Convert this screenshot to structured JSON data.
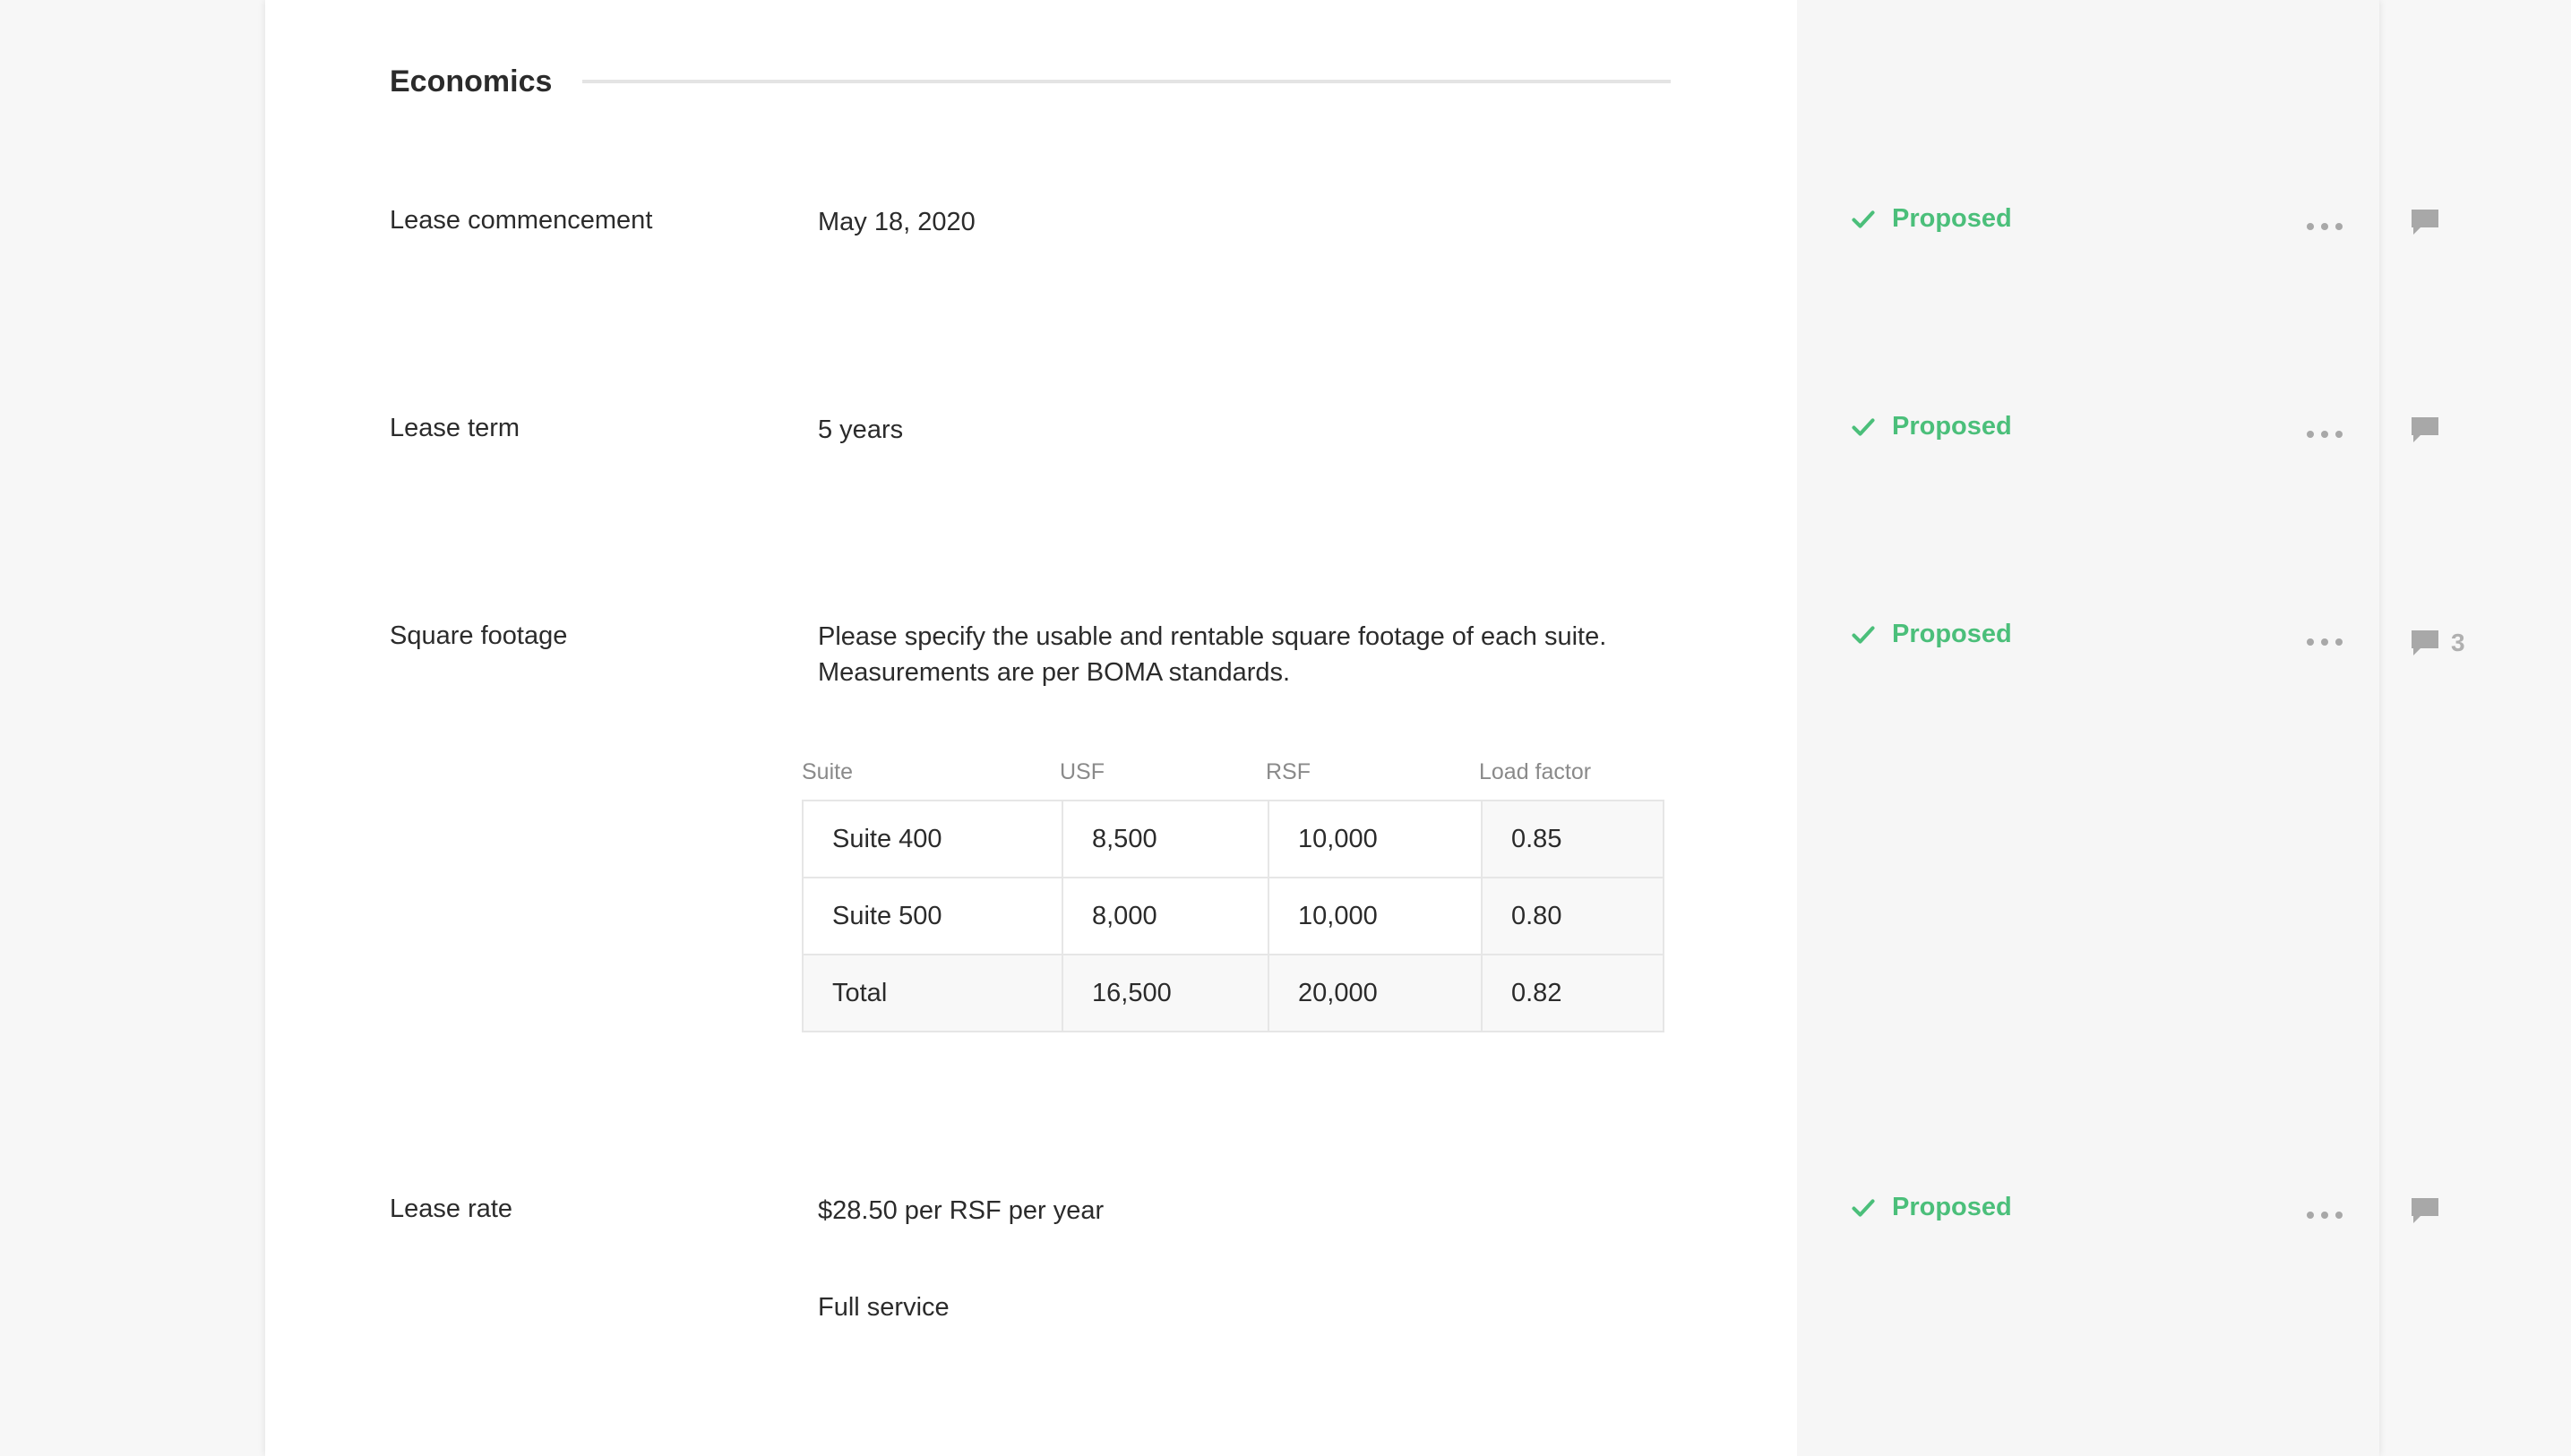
{
  "section": {
    "title": "Economics"
  },
  "rows": [
    {
      "label": "Lease commencement",
      "value": "May 18, 2020",
      "status": "Proposed",
      "comment_count": ""
    },
    {
      "label": "Lease term",
      "value": "5 years",
      "status": "Proposed",
      "comment_count": ""
    },
    {
      "label": "Square footage",
      "value_line1": "Please specify the usable and rentable square footage of each suite.",
      "value_line2": "Measurements are per BOMA standards.",
      "status": "Proposed",
      "comment_count": "3"
    },
    {
      "label": "Lease rate",
      "value": "$28.50 per RSF per year",
      "value_extra": "Full service",
      "status": "Proposed",
      "comment_count": ""
    }
  ],
  "sf_table": {
    "headers": [
      "Suite",
      "USF",
      "RSF",
      "Load factor"
    ],
    "rows": [
      [
        "Suite 400",
        "8,500",
        "10,000",
        "0.85"
      ],
      [
        "Suite 500",
        "8,000",
        "10,000",
        "0.80"
      ],
      [
        "Total",
        "16,500",
        "20,000",
        "0.82"
      ]
    ]
  },
  "icons": {
    "status": "check-icon",
    "menu": "more-options-icon",
    "comment": "comment-icon"
  },
  "colors": {
    "proposed": "#4bbf7a",
    "icon_gray": "#a8a8a8",
    "status_column_bg": "#f6f6f6"
  }
}
